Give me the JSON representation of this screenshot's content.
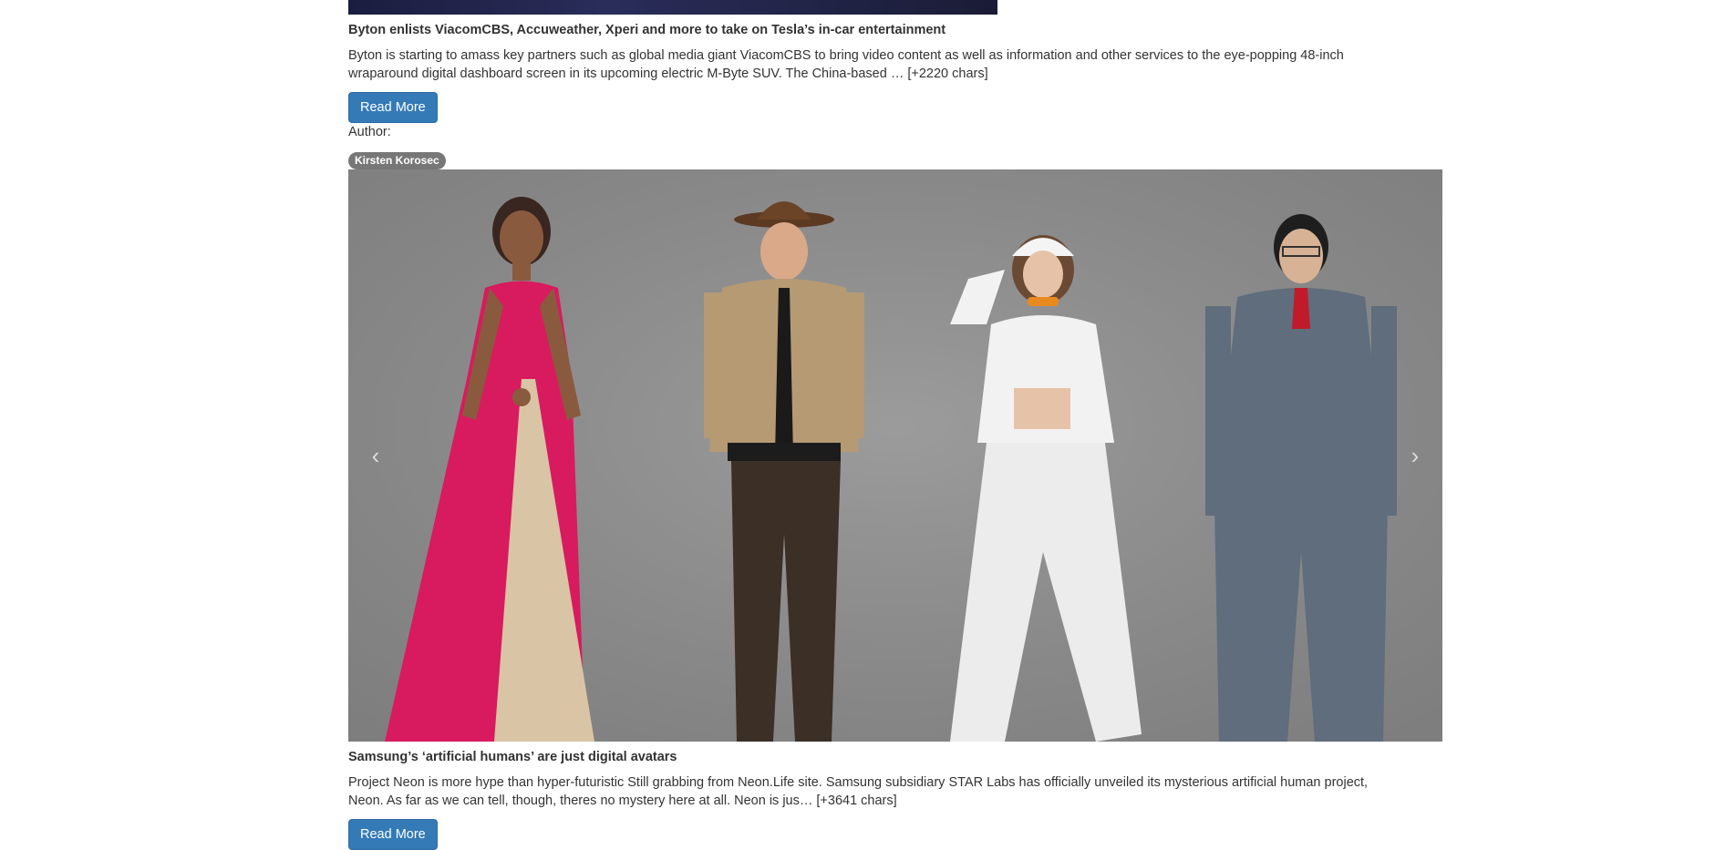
{
  "articles": [
    {
      "title": "Byton enlists ViacomCBS, Accuweather, Xperi and more to take on Tesla’s in-car entertainment",
      "description": "Byton is starting to amass key partners such as global media giant ViacomCBS to bring video content as well as information and other services to the eye-popping 48-inch wraparound digital dashboard screen in its upcoming electric M-Byte SUV. The China-based … [+2220 chars]",
      "read_more_label": "Read More",
      "author_label": "Author:",
      "author": "Kirsten Korosec"
    },
    {
      "title": "Samsung’s ‘artificial humans’ are just digital avatars",
      "description": "Project Neon is more hype than hyper-futuristic Still grabbing from Neon.Life site. Samsung subsidiary STAR Labs has officially unveiled its mysterious artificial human project, Neon. As far as we can tell, though, theres no mystery here at all. Neon is jus… [+3641 chars]",
      "read_more_label": "Read More"
    }
  ],
  "carousel": {
    "prev_icon": "‹",
    "next_icon": "›"
  },
  "colors": {
    "button_bg": "#337ab7",
    "badge_bg": "#777777",
    "text": "#333333"
  }
}
